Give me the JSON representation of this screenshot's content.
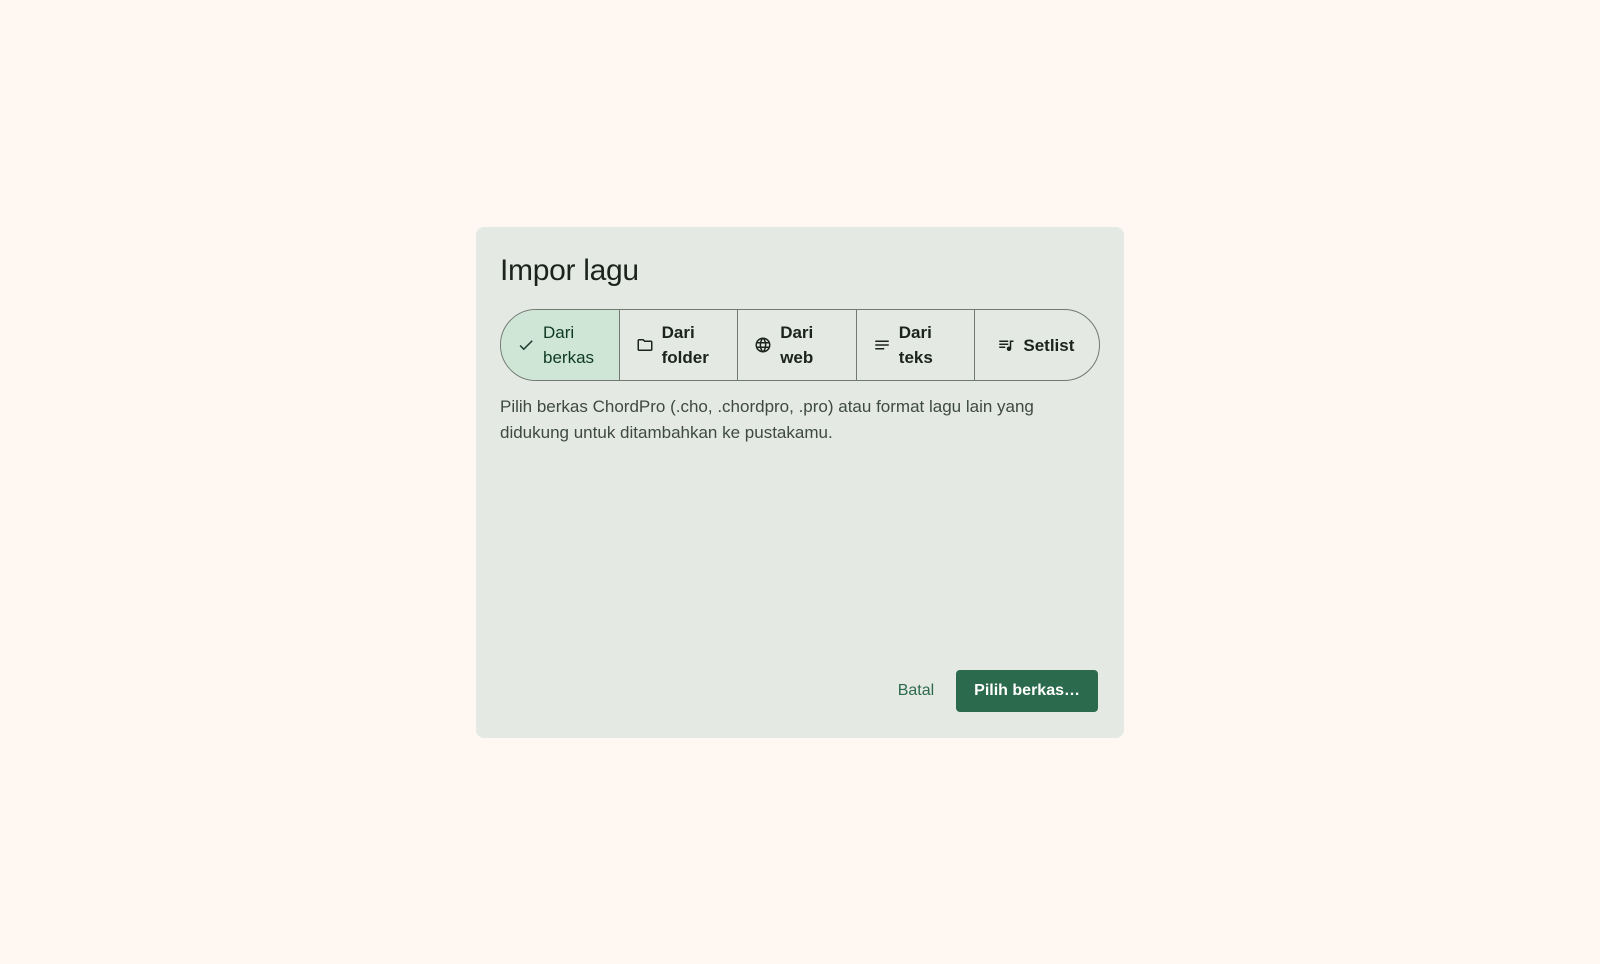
{
  "dialog": {
    "title": "Impor lagu",
    "tabs": [
      {
        "label": "Dari berkas",
        "icon": "check-icon",
        "selected": true
      },
      {
        "label": "Dari folder",
        "icon": "folder-icon",
        "selected": false
      },
      {
        "label": "Dari web",
        "icon": "globe-icon",
        "selected": false
      },
      {
        "label": "Dari teks",
        "icon": "notes-icon",
        "selected": false
      },
      {
        "label": "Setlist",
        "icon": "queue-music-icon",
        "selected": false
      }
    ],
    "description": "Pilih berkas ChordPro (.cho, .chordpro, .pro) atau format lagu lain yang didukung untuk ditambahkan ke pustakamu.",
    "cancel_label": "Batal",
    "confirm_label": "Pilih berkas…"
  },
  "colors": {
    "page_background": "#fff8f2",
    "dialog_background": "#e4e9e3",
    "selected_tab": "#cfe6d6",
    "primary": "#2c6a4d"
  }
}
